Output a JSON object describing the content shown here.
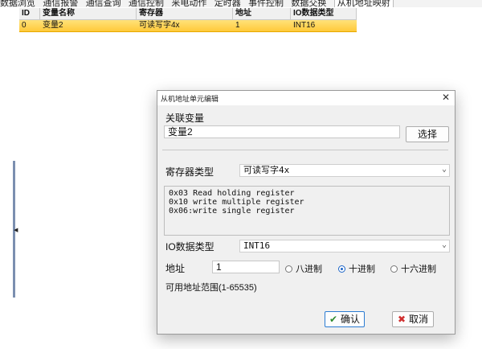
{
  "menubar": {
    "items": [
      "数据浏览",
      "通信报警",
      "通信查询",
      "通信控制",
      "来电动作",
      "定时器",
      "事件控制",
      "数据交换",
      "从机地址映射"
    ]
  },
  "table": {
    "headers": [
      "ID",
      "变量名称",
      "寄存器",
      "地址",
      "IO数据类型"
    ],
    "rows": [
      [
        "0",
        "变量2",
        "可读写字4x",
        "1",
        "INT16"
      ]
    ]
  },
  "dialog": {
    "title": "从机地址单元编辑",
    "linked_var_label": "关联变量",
    "linked_var_value": "变量2",
    "choose_button": "选择",
    "register_type_label": "寄存器类型",
    "register_type_value": "可读写字4x",
    "function_codes": [
      "0x03 Read holding register",
      "0x10 write multiple register",
      "0x06:write single register"
    ],
    "io_type_label": "IO数据类型",
    "io_type_value": "INT16",
    "address_label": "地址",
    "address_value": "1",
    "radix_options": [
      {
        "label": "八进制",
        "checked": false
      },
      {
        "label": "十进制",
        "checked": true
      },
      {
        "label": "十六进制",
        "checked": false
      }
    ],
    "range_text": "可用地址范围(1-65535)",
    "ok_button": "确认",
    "cancel_button": "取消"
  }
}
